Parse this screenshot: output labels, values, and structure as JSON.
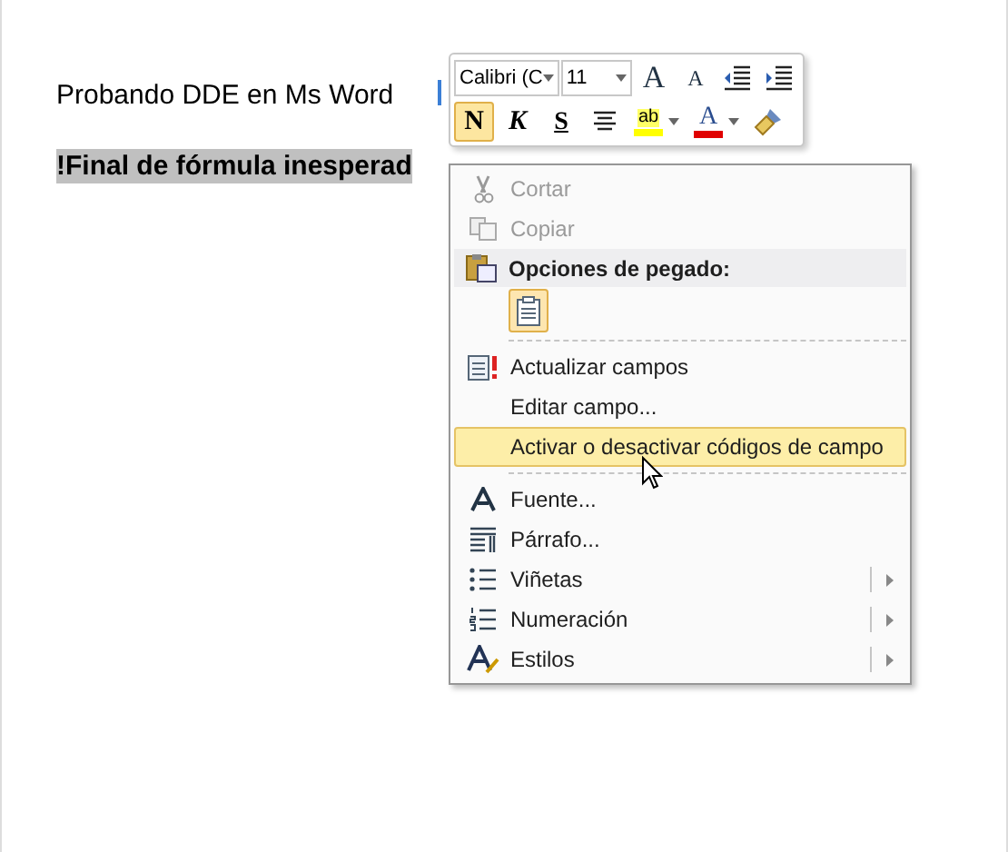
{
  "document": {
    "paragraphs": [
      {
        "text": "Probando DDE en Ms Word",
        "bold": false,
        "highlighted": false
      },
      {
        "text": "!Final de fórmula inesperad",
        "bold": true,
        "highlighted": true
      }
    ]
  },
  "mini_toolbar": {
    "font": "Calibri (C",
    "size": "11",
    "buttons": [
      {
        "kind": "grow",
        "label": "A",
        "selected": false
      },
      {
        "kind": "shrink",
        "label": "A",
        "selected": false
      },
      {
        "kind": "outdent",
        "selected": false
      },
      {
        "kind": "indent",
        "selected": false
      },
      {
        "kind": "bold",
        "label": "N",
        "selected": true
      },
      {
        "kind": "italic",
        "label": "K",
        "selected": false
      },
      {
        "kind": "underline",
        "label": "S",
        "selected": false
      },
      {
        "kind": "center",
        "selected": false
      },
      {
        "kind": "highlight",
        "label": "ab",
        "selected": false
      },
      {
        "kind": "fontcolor",
        "label": "A",
        "selected": false
      },
      {
        "kind": "painter",
        "selected": false
      }
    ]
  },
  "context_menu": {
    "items": [
      {
        "kind": "item",
        "label": "Cortar",
        "disabled": true,
        "selected": false,
        "submenu": false
      },
      {
        "kind": "item",
        "label": "Copiar",
        "disabled": true,
        "selected": false,
        "submenu": false
      },
      {
        "kind": "header",
        "label": "Opciones de pegado:"
      },
      {
        "kind": "paste"
      },
      {
        "kind": "separator"
      },
      {
        "kind": "item",
        "label": "Actualizar campos",
        "disabled": false,
        "selected": false,
        "submenu": false
      },
      {
        "kind": "item",
        "label": "Editar campo...",
        "disabled": false,
        "selected": false,
        "submenu": false
      },
      {
        "kind": "item",
        "label": "Activar o desactivar códigos de campo",
        "disabled": false,
        "selected": true,
        "submenu": false
      },
      {
        "kind": "separator"
      },
      {
        "kind": "item",
        "label": "Fuente...",
        "disabled": false,
        "selected": false,
        "submenu": false
      },
      {
        "kind": "item",
        "label": "Párrafo...",
        "disabled": false,
        "selected": false,
        "submenu": false
      },
      {
        "kind": "item",
        "label": "Viñetas",
        "disabled": false,
        "selected": false,
        "submenu": true
      },
      {
        "kind": "item",
        "label": "Numeración",
        "disabled": false,
        "selected": false,
        "submenu": true
      },
      {
        "kind": "item",
        "label": "Estilos",
        "disabled": false,
        "selected": false,
        "submenu": true
      }
    ]
  }
}
